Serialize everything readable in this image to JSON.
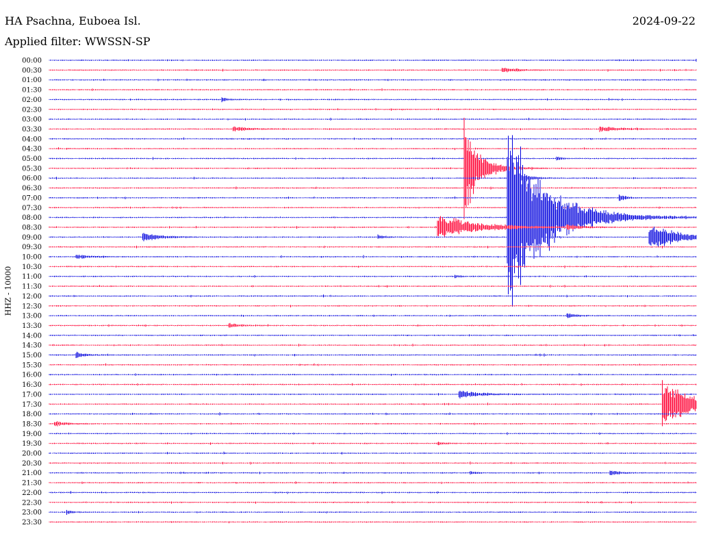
{
  "header": {
    "station": "HA Psachna, Euboea Isl.",
    "filter": "Applied filter: WWSSN-SP",
    "date": "2024-09-22"
  },
  "colors": {
    "trace_a": "#0000dd",
    "trace_b": "#ff0033"
  },
  "chart_data": {
    "type": "line",
    "title": "HA Psachna, Euboea Isl.",
    "subtitle": "Applied filter: WWSSN-SP",
    "ylabel": "HHZ - 10000",
    "xlabel": "",
    "minutes_per_line": 30,
    "line_labels": [
      "00:00",
      "00:30",
      "01:00",
      "01:30",
      "02:00",
      "02:30",
      "03:00",
      "03:30",
      "04:00",
      "04:30",
      "05:00",
      "05:30",
      "06:00",
      "06:30",
      "07:00",
      "07:30",
      "08:00",
      "08:30",
      "09:00",
      "09:30",
      "10:00",
      "10:30",
      "11:00",
      "11:30",
      "12:00",
      "12:30",
      "13:00",
      "13:30",
      "14:00",
      "14:30",
      "15:00",
      "15:30",
      "16:00",
      "16:30",
      "17:00",
      "17:30",
      "18:00",
      "18:30",
      "19:00",
      "19:30",
      "20:00",
      "20:30",
      "21:00",
      "21:30",
      "22:00",
      "22:30",
      "23:00",
      "23:30"
    ],
    "line_color_cycle": [
      "blue",
      "red"
    ],
    "events": [
      {
        "line": "00:30",
        "minute": 21.0,
        "amp": 0.3,
        "dur_min": 1.0
      },
      {
        "line": "02:00",
        "minute": 8.0,
        "amp": 0.3,
        "dur_min": 0.3
      },
      {
        "line": "03:30",
        "minute": 8.5,
        "amp": 0.3,
        "dur_min": 1.0
      },
      {
        "line": "03:30",
        "minute": 25.5,
        "amp": 0.3,
        "dur_min": 1.3
      },
      {
        "line": "05:00",
        "minute": 23.5,
        "amp": 0.3,
        "dur_min": 0.3
      },
      {
        "line": "05:30",
        "minute": 19.2,
        "amp": 6.0,
        "dur_min": 1.0
      },
      {
        "line": "06:00",
        "minute": 21.8,
        "amp": 0.8,
        "dur_min": 0.6
      },
      {
        "line": "07:00",
        "minute": 26.4,
        "amp": 0.5,
        "dur_min": 0.4
      },
      {
        "line": "08:00",
        "minute": 21.2,
        "amp": 12.0,
        "dur_min": 2.5
      },
      {
        "line": "08:30",
        "minute": 18.0,
        "amp": 1.5,
        "dur_min": 2.5
      },
      {
        "line": "08:30",
        "minute": 24.0,
        "amp": 0.3,
        "dur_min": 0.8
      },
      {
        "line": "09:00",
        "minute": 4.3,
        "amp": 0.6,
        "dur_min": 1.0
      },
      {
        "line": "09:00",
        "minute": 15.2,
        "amp": 0.3,
        "dur_min": 0.4
      },
      {
        "line": "09:00",
        "minute": 27.8,
        "amp": 1.7,
        "dur_min": 1.8
      },
      {
        "line": "10:00",
        "minute": 1.2,
        "amp": 0.3,
        "dur_min": 0.8
      },
      {
        "line": "11:00",
        "minute": 18.8,
        "amp": 0.2,
        "dur_min": 0.3
      },
      {
        "line": "12:00",
        "minute": 31.0,
        "amp": 0.3,
        "dur_min": 0.3
      },
      {
        "line": "13:00",
        "minute": 24.0,
        "amp": 0.3,
        "dur_min": 0.6
      },
      {
        "line": "13:30",
        "minute": 8.3,
        "amp": 0.3,
        "dur_min": 0.6
      },
      {
        "line": "14:30",
        "minute": 31.0,
        "amp": 0.4,
        "dur_min": 0.3
      },
      {
        "line": "15:00",
        "minute": 1.2,
        "amp": 0.4,
        "dur_min": 0.6
      },
      {
        "line": "17:00",
        "minute": 19.0,
        "amp": 0.4,
        "dur_min": 1.5
      },
      {
        "line": "17:30",
        "minute": 28.4,
        "amp": 3.2,
        "dur_min": 1.8
      },
      {
        "line": "18:30",
        "minute": 0.2,
        "amp": 0.3,
        "dur_min": 0.8
      },
      {
        "line": "19:30",
        "minute": 18.0,
        "amp": 0.2,
        "dur_min": 0.5
      },
      {
        "line": "21:00",
        "minute": 19.5,
        "amp": 0.3,
        "dur_min": 0.3
      },
      {
        "line": "21:00",
        "minute": 26.0,
        "amp": 0.3,
        "dur_min": 0.6
      },
      {
        "line": "23:00",
        "minute": 0.8,
        "amp": 0.3,
        "dur_min": 0.3
      }
    ]
  }
}
